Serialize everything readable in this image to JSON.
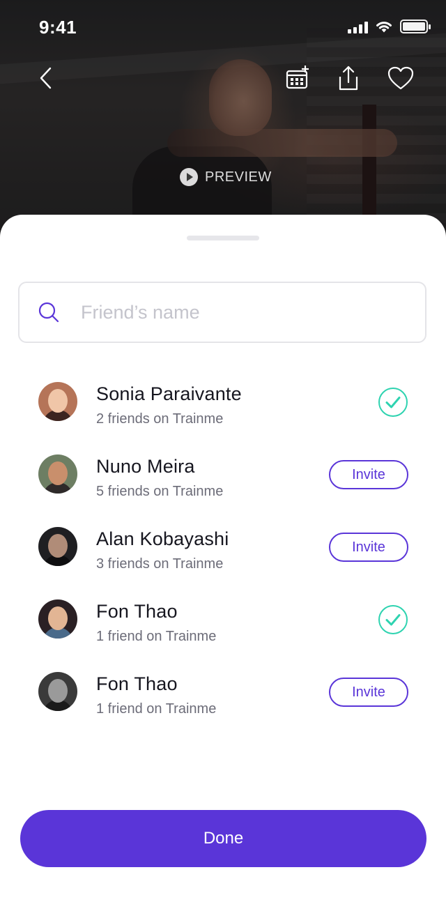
{
  "status_bar": {
    "time": "9:41"
  },
  "hero": {
    "preview_label": "PREVIEW"
  },
  "search": {
    "placeholder": "Friend’s name",
    "value": ""
  },
  "friends": [
    {
      "name": "Sonia Paraivante",
      "subtitle": "2 friends on Trainme",
      "status": "invited"
    },
    {
      "name": "Nuno Meira",
      "subtitle": "5 friends on Trainme",
      "status": "invite",
      "button_label": "Invite"
    },
    {
      "name": "Alan Kobayashi",
      "subtitle": "3 friends on Trainme",
      "status": "invite",
      "button_label": "Invite"
    },
    {
      "name": "Fon Thao",
      "subtitle": "1 friend on Trainme",
      "status": "invited"
    },
    {
      "name": "Fon Thao",
      "subtitle": "1 friend on Trainme",
      "status": "invite",
      "button_label": "Invite"
    }
  ],
  "done_label": "Done",
  "colors": {
    "accent": "#5A35D8",
    "check": "#2ED3B0",
    "text_primary": "#16161F",
    "text_secondary": "#6C6C78",
    "placeholder": "#C4C4CC"
  },
  "icons": {
    "back": "chevron-left-icon",
    "calendar": "calendar-add-icon",
    "share": "share-icon",
    "favorite": "heart-icon",
    "preview": "play-icon",
    "search": "search-icon",
    "invited": "check-circle-icon"
  }
}
